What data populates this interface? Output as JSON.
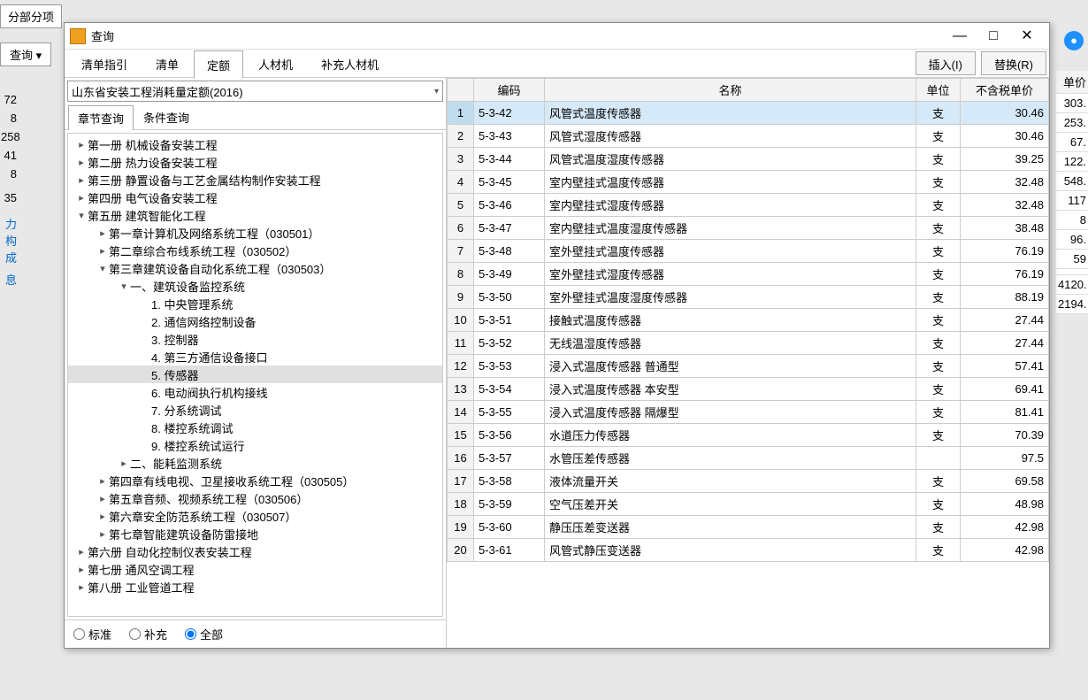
{
  "bg": {
    "main_tab": "分部分项",
    "dropdown_label": "查询 ▾",
    "right_header": "单价",
    "right_values": [
      "303.",
      "253.",
      "67.",
      "122.",
      "548.",
      "117",
      "8",
      "96.",
      "59",
      "",
      "4120.",
      "2194."
    ],
    "side_left": [
      "",
      "",
      "72",
      "8",
      "258",
      "41",
      "8",
      "",
      "35",
      "",
      "力构成",
      "息"
    ]
  },
  "dialog": {
    "title": "查询",
    "win": {
      "min": "—",
      "max": "□",
      "close": "✕"
    },
    "tabs": [
      "清单指引",
      "清单",
      "定额",
      "人材机",
      "补充人材机"
    ],
    "active_tab": 2,
    "actions": {
      "insert": "插入(I)",
      "replace": "替换(R)"
    },
    "dataset_combo": "山东省安装工程消耗量定额(2016)",
    "subtabs": [
      "章节查询",
      "条件查询"
    ],
    "active_subtab": 0,
    "radios": [
      "标准",
      "补充",
      "全部"
    ],
    "radio_selected": 2
  },
  "tree": [
    {
      "d": 0,
      "t": ">",
      "l": "第一册  机械设备安装工程"
    },
    {
      "d": 0,
      "t": ">",
      "l": "第二册  热力设备安装工程"
    },
    {
      "d": 0,
      "t": ">",
      "l": "第三册  静置设备与工艺金属结构制作安装工程"
    },
    {
      "d": 0,
      "t": ">",
      "l": "第四册  电气设备安装工程"
    },
    {
      "d": 0,
      "t": "v",
      "l": "第五册  建筑智能化工程"
    },
    {
      "d": 1,
      "t": ">",
      "l": "第一章计算机及网络系统工程（030501）"
    },
    {
      "d": 1,
      "t": ">",
      "l": "第二章综合布线系统工程（030502）"
    },
    {
      "d": 1,
      "t": "v",
      "l": "第三章建筑设备自动化系统工程（030503）"
    },
    {
      "d": 2,
      "t": "v",
      "l": "一、建筑设备监控系统"
    },
    {
      "d": 3,
      "t": "",
      "l": "1. 中央管理系统"
    },
    {
      "d": 3,
      "t": "",
      "l": "2. 通信网络控制设备"
    },
    {
      "d": 3,
      "t": "",
      "l": "3. 控制器"
    },
    {
      "d": 3,
      "t": "",
      "l": "4. 第三方通信设备接口"
    },
    {
      "d": 3,
      "t": "",
      "l": "5. 传感器",
      "sel": true
    },
    {
      "d": 3,
      "t": "",
      "l": "6. 电动阀执行机构接线"
    },
    {
      "d": 3,
      "t": "",
      "l": "7. 分系统调试"
    },
    {
      "d": 3,
      "t": "",
      "l": "8. 楼控系统调试"
    },
    {
      "d": 3,
      "t": "",
      "l": "9. 楼控系统试运行"
    },
    {
      "d": 2,
      "t": ">",
      "l": "二、能耗监测系统"
    },
    {
      "d": 1,
      "t": ">",
      "l": "第四章有线电视、卫星接收系统工程（030505）"
    },
    {
      "d": 1,
      "t": ">",
      "l": "第五章音频、视频系统工程（030506）"
    },
    {
      "d": 1,
      "t": ">",
      "l": "第六章安全防范系统工程（030507）"
    },
    {
      "d": 1,
      "t": ">",
      "l": "第七章智能建筑设备防雷接地"
    },
    {
      "d": 0,
      "t": ">",
      "l": "第六册  自动化控制仪表安装工程"
    },
    {
      "d": 0,
      "t": ">",
      "l": "第七册  通风空调工程"
    },
    {
      "d": 0,
      "t": ">",
      "l": "第八册  工业管道工程"
    }
  ],
  "table": {
    "headers": [
      "",
      "编码",
      "名称",
      "单位",
      "不含税单价"
    ],
    "rows": [
      {
        "n": 1,
        "code": "5-3-42",
        "name": "风管式温度传感器",
        "unit": "支",
        "price": "30.46",
        "sel": true
      },
      {
        "n": 2,
        "code": "5-3-43",
        "name": "风管式湿度传感器",
        "unit": "支",
        "price": "30.46"
      },
      {
        "n": 3,
        "code": "5-3-44",
        "name": "风管式温度湿度传感器",
        "unit": "支",
        "price": "39.25"
      },
      {
        "n": 4,
        "code": "5-3-45",
        "name": "室内壁挂式温度传感器",
        "unit": "支",
        "price": "32.48"
      },
      {
        "n": 5,
        "code": "5-3-46",
        "name": "室内壁挂式湿度传感器",
        "unit": "支",
        "price": "32.48"
      },
      {
        "n": 6,
        "code": "5-3-47",
        "name": "室内壁挂式温度湿度传感器",
        "unit": "支",
        "price": "38.48"
      },
      {
        "n": 7,
        "code": "5-3-48",
        "name": "室外壁挂式温度传感器",
        "unit": "支",
        "price": "76.19"
      },
      {
        "n": 8,
        "code": "5-3-49",
        "name": "室外壁挂式湿度传感器",
        "unit": "支",
        "price": "76.19"
      },
      {
        "n": 9,
        "code": "5-3-50",
        "name": "室外壁挂式温度湿度传感器",
        "unit": "支",
        "price": "88.19"
      },
      {
        "n": 10,
        "code": "5-3-51",
        "name": "接触式温度传感器",
        "unit": "支",
        "price": "27.44"
      },
      {
        "n": 11,
        "code": "5-3-52",
        "name": "无线温湿度传感器",
        "unit": "支",
        "price": "27.44"
      },
      {
        "n": 12,
        "code": "5-3-53",
        "name": "浸入式温度传感器  普通型",
        "unit": "支",
        "price": "57.41"
      },
      {
        "n": 13,
        "code": "5-3-54",
        "name": "浸入式温度传感器  本安型",
        "unit": "支",
        "price": "69.41"
      },
      {
        "n": 14,
        "code": "5-3-55",
        "name": "浸入式温度传感器  隔爆型",
        "unit": "支",
        "price": "81.41"
      },
      {
        "n": 15,
        "code": "5-3-56",
        "name": "水道压力传感器",
        "unit": "支",
        "price": "70.39"
      },
      {
        "n": 16,
        "code": "5-3-57",
        "name": "水管压差传感器",
        "unit": "",
        "price": "97.5"
      },
      {
        "n": 17,
        "code": "5-3-58",
        "name": "液体流量开关",
        "unit": "支",
        "price": "69.58"
      },
      {
        "n": 18,
        "code": "5-3-59",
        "name": "空气压差开关",
        "unit": "支",
        "price": "48.98"
      },
      {
        "n": 19,
        "code": "5-3-60",
        "name": "静压压差变送器",
        "unit": "支",
        "price": "42.98"
      },
      {
        "n": 20,
        "code": "5-3-61",
        "name": "风管式静压变送器",
        "unit": "支",
        "price": "42.98"
      }
    ]
  }
}
